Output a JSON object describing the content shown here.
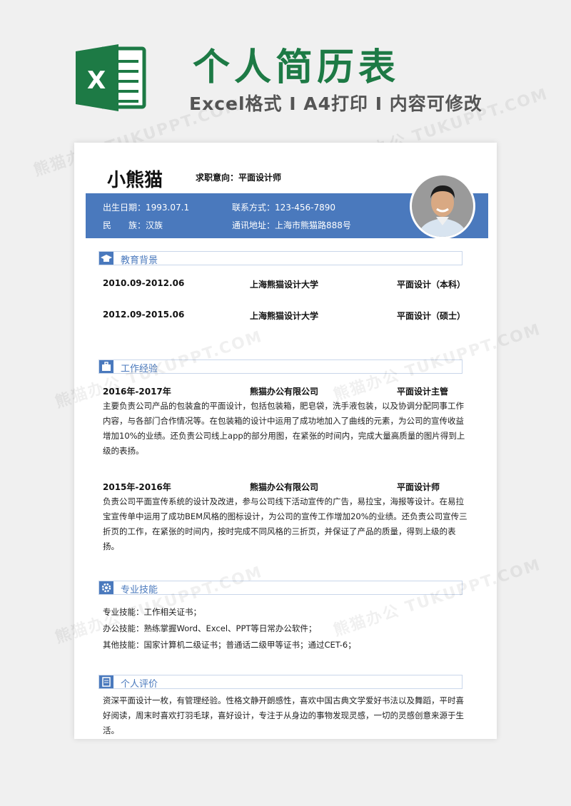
{
  "banner": {
    "title": "个人简历表",
    "subtitle": "Excel格式 I A4打印 I 内容可修改",
    "excel_letter": "X",
    "watermark": "熊猫办公 TUKUPPT.COM"
  },
  "header": {
    "name": "小熊猫",
    "intent": "求职意向：平面设计师"
  },
  "info": {
    "birth": "出生日期：1993.07.1",
    "phone": "联系方式：123-456-7890",
    "ethnic": "民　　族：汉族",
    "address": "通讯地址：上海市熊猫路888号"
  },
  "education": {
    "title": "教育背景",
    "rows": [
      {
        "date": "2010.09-2012.06",
        "school": "上海熊猫设计大学",
        "degree": "平面设计（本科）"
      },
      {
        "date": "2012.09-2015.06",
        "school": "上海熊猫设计大学",
        "degree": "平面设计（硕士）"
      }
    ]
  },
  "work": {
    "title": "工作经验",
    "jobs": [
      {
        "date": "2016年-2017年",
        "company": "熊猫办公有限公司",
        "position": "平面设计主管",
        "text": "主要负责公司产品的包装盒的平面设计，包括包装箱，肥皂袋，洗手液包装，以及协调分配同事工作内容，与各部门合作情况等。在包装箱的设计中运用了成功地加入了曲线的元素，为公司的宣传收益增加10%的业绩。还负责公司线上app的部分用图，在紧张的时间内，完成大量高质量的图片得到上级的表扬。"
      },
      {
        "date": "2015年-2016年",
        "company": "熊猫办公有限公司",
        "position": "平面设计师",
        "text": "负责公司平面宣传系统的设计及改进，参与公司线下活动宣传的广告，易拉宝，海报等设计。在易拉宝宣传单中运用了成功BEM风格的图标设计，为公司的宣传工作增加20%的业绩。还负责公司宣传三折页的工作，在紧张的时间内，按时完成不同风格的三折页，并保证了产品的质量，得到上级的表扬。"
      }
    ]
  },
  "skills": {
    "title": "专业技能",
    "lines": [
      "专业技能：工作相关证书；",
      "办公技能：熟练掌握Word、Excel、PPT等日常办公软件；",
      "其他技能：国家计算机二级证书；普通话二级甲等证书；通过CET-6；"
    ]
  },
  "evaluation": {
    "title": "个人评价",
    "text": "资深平面设计一枚，有管理经验。性格文静开朗感性，喜欢中国古典文学爱好书法以及舞蹈，平时喜好阅读，周末时喜欢打羽毛球，喜好设计，专注于从身边的事物发现灵感，一切的灵感创意来源于生活。"
  },
  "colors": {
    "brand_green": "#1d7a45",
    "accent_blue": "#4a79bd"
  }
}
